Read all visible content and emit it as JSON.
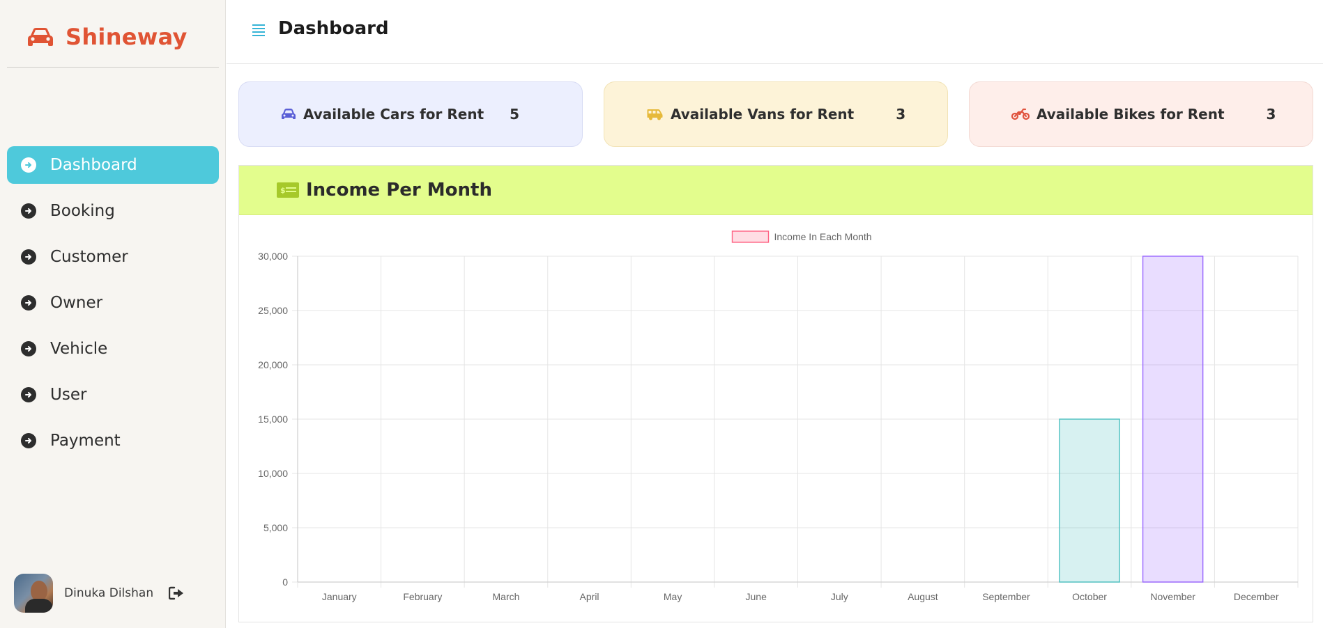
{
  "brand": {
    "name": "Shineway",
    "icon": "car-icon",
    "color": "#e05434"
  },
  "header": {
    "title": "Dashboard",
    "menu_icon": "menu-icon"
  },
  "sidebar": {
    "items": [
      {
        "label": "Dashboard",
        "active": true
      },
      {
        "label": "Booking",
        "active": false
      },
      {
        "label": "Customer",
        "active": false
      },
      {
        "label": "Owner",
        "active": false
      },
      {
        "label": "Vehicle",
        "active": false
      },
      {
        "label": "User",
        "active": false
      },
      {
        "label": "Payment",
        "active": false
      }
    ],
    "active_color": "#4ec9db"
  },
  "user": {
    "name": "Dinuka Dilshan",
    "logout_icon": "logout-icon"
  },
  "cards": [
    {
      "label": "Available Cars for Rent",
      "value": "5",
      "icon": "car-icon",
      "icon_color": "#5a5fd6",
      "bg": "#eceffe"
    },
    {
      "label": "Available Vans for Rent",
      "value": "3",
      "icon": "van-icon",
      "icon_color": "#e6b93a",
      "bg": "#fdf3d8"
    },
    {
      "label": "Available Bikes for Rent",
      "value": "3",
      "icon": "motorcycle-icon",
      "icon_color": "#e0543f",
      "bg": "#feeeea"
    }
  ],
  "income_panel": {
    "title": "Income Per Month",
    "icon": "money-bill-icon",
    "header_bg": "#e3fd8d"
  },
  "chart_data": {
    "type": "bar",
    "categories": [
      "January",
      "February",
      "March",
      "April",
      "May",
      "June",
      "July",
      "August",
      "September",
      "October",
      "November",
      "December"
    ],
    "series": [
      {
        "name": "Income In Each Month",
        "values": [
          0,
          0,
          0,
          0,
          0,
          0,
          0,
          0,
          0,
          15000,
          30000,
          0
        ]
      }
    ],
    "bar_colors": {
      "October": "#4bc0c0",
      "November": "#9966ff"
    },
    "legend_color": "#ff6384",
    "ylim": [
      0,
      30000
    ],
    "yticks": [
      0,
      5000,
      10000,
      15000,
      20000,
      25000,
      30000
    ],
    "ytick_labels": [
      "0",
      "5,000",
      "10,000",
      "15,000",
      "20,000",
      "25,000",
      "30,000"
    ],
    "grid": true,
    "legend_position": "top"
  }
}
